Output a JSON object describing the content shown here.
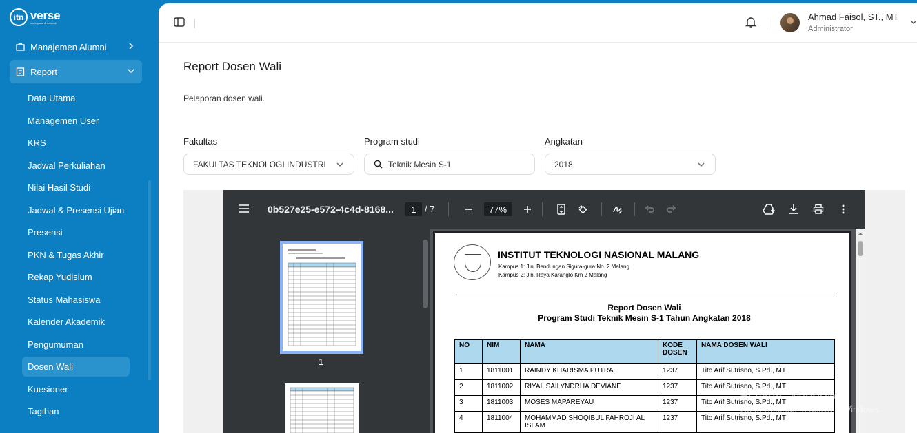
{
  "brand": {
    "mark": "itn",
    "name": "verse",
    "tagline": "workspace & network"
  },
  "sidebar": {
    "groups": [
      {
        "label": "Manajemen Alumni",
        "icon": "briefcase-icon"
      },
      {
        "label": "Report",
        "icon": "report-icon"
      }
    ],
    "items": [
      {
        "label": "Data Utama"
      },
      {
        "label": "Managemen User"
      },
      {
        "label": "KRS"
      },
      {
        "label": "Jadwal Perkuliahan"
      },
      {
        "label": "Nilai Hasil Studi"
      },
      {
        "label": "Jadwal & Presensi Ujian"
      },
      {
        "label": "Presensi"
      },
      {
        "label": "PKN & Tugas Akhir"
      },
      {
        "label": "Rekap Yudisium"
      },
      {
        "label": "Status Mahasiswa"
      },
      {
        "label": "Kalender Akademik"
      },
      {
        "label": "Pengumuman"
      },
      {
        "label": "Dosen Wali",
        "active": true
      },
      {
        "label": "Kuesioner"
      },
      {
        "label": "Tagihan"
      }
    ]
  },
  "header": {
    "user_name": "Ahmad Faisol, ST., MT",
    "user_role": "Administrator"
  },
  "page": {
    "title": "Report Dosen Wali",
    "description": "Pelaporan dosen wali."
  },
  "filters": {
    "fakultas": {
      "label": "Fakultas",
      "value": "FAKULTAS TEKNOLOGI INDUSTRI"
    },
    "prodi": {
      "label": "Program studi",
      "value": "Teknik Mesin S-1"
    },
    "angkatan": {
      "label": "Angkatan",
      "value": "2018"
    }
  },
  "pdf_viewer": {
    "file_name": "0b527e25-e572-4c4d-8168...",
    "current_page": "1",
    "total_pages": "/ 7",
    "zoom": "77%",
    "thumbnail_label": "1"
  },
  "document": {
    "institution": "INSTITUT TEKNOLOGI NASIONAL MALANG",
    "address1": "Kampus 1: Jln. Bendungan Sigura-gura No. 2 Malang",
    "address2": "Kampus 2: Jln. Raya Karanglo Km 2 Malang",
    "title": "Report Dosen Wali",
    "subtitle": "Program Studi Teknik Mesin S-1 Tahun Angkatan 2018",
    "columns": [
      "NO",
      "NIM",
      "NAMA",
      "KODE DOSEN",
      "NAMA DOSEN WALI"
    ],
    "rows": [
      [
        "1",
        "1811001",
        "RAINDY KHARISMA PUTRA",
        "1237",
        "Tito Arif Sutrisno, S.Pd., MT"
      ],
      [
        "2",
        "1811002",
        "RIYAL SAILYNDRHA DEVIANE",
        "1237",
        "Tito Arif Sutrisno, S.Pd., MT"
      ],
      [
        "3",
        "1811003",
        "MOSES MAPAREYAU",
        "1237",
        "Tito Arif Sutrisno, S.Pd., MT"
      ],
      [
        "4",
        "1811004",
        "MOHAMMAD SHOQIBUL FAHROJI AL ISLAM",
        "1237",
        "Tito Arif Sutrisno, S.Pd., MT"
      ]
    ]
  },
  "watermark": {
    "line1": "Activate Windows",
    "line2": "Go to Settings to activate Windows."
  },
  "colors": {
    "sidebar": "#0b7fc1",
    "active_item": "#2a92cc",
    "table_header": "#add8ee",
    "pdf_toolbar": "#323639"
  }
}
